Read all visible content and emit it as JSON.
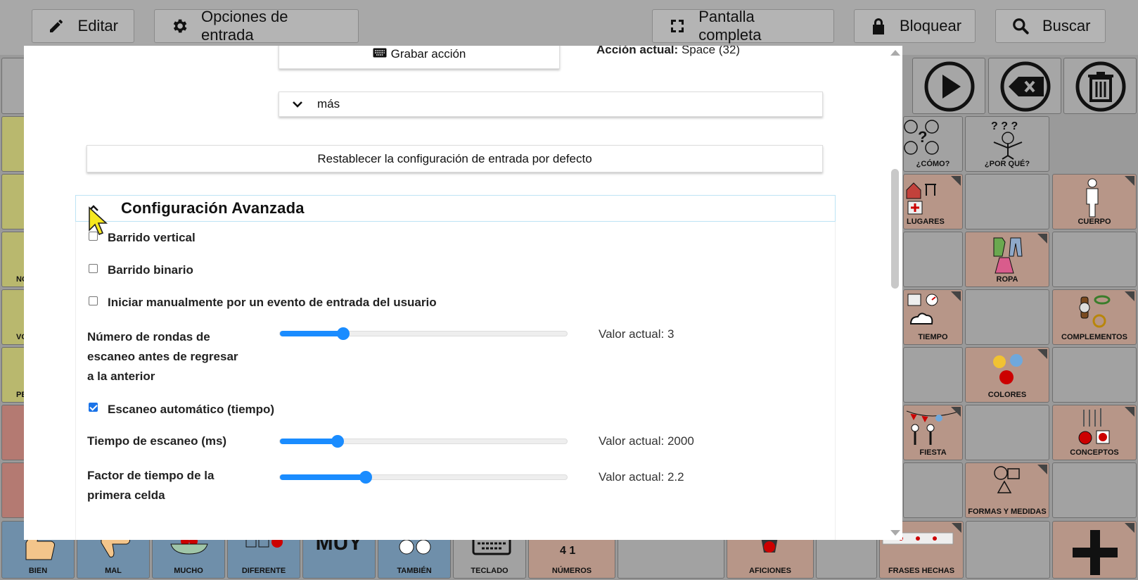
{
  "toolbar": {
    "edit_label": "Editar",
    "input_options_label": "Opciones de entrada",
    "fullscreen_label": "Pantalla completa",
    "lock_label": "Bloquear",
    "search_label": "Buscar"
  },
  "grid": {
    "labels": {
      "como": "¿CÓMO?",
      "por_que": "¿POR QUÉ?",
      "lugares": "LUGARES",
      "cuerpo": "CUERPO",
      "ropa": "ROPA",
      "tiempo": "TIEMPO",
      "complementos": "COMPLEMENTOS",
      "colores": "COLORES",
      "fiesta": "FIESTA",
      "conceptos": "CONCEPTOS",
      "formas": "FORMAS Y MEDIDAS",
      "bien": "BIEN",
      "mal": "MAL",
      "mucho": "MUCHO",
      "diferente": "DIFERENTE",
      "muy": "MUY",
      "tambien": "TAMBIÉN",
      "teclado": "TECLADO",
      "numeros": "NÚMEROS",
      "aficiones": "AFICIONES",
      "frases": "FRASES HECHAS",
      "no_partial": "NO",
      "vo_partial": "VO",
      "pe_partial": "PE"
    },
    "colors": {
      "yellow": "#b9b86e",
      "red": "#b47a72",
      "pink": "#b79688",
      "blue": "#6f8faa"
    }
  },
  "modal": {
    "record_action_label": "Grabar acción",
    "current_action_label": "Acción actual:",
    "current_action_value": "Space (32)",
    "more_label": "más",
    "reset_label": "Restablecer la configuración de entrada por defecto",
    "advanced": {
      "title": "Configuración Avanzada",
      "vertical_scan_label": "Barrido vertical",
      "vertical_scan_checked": false,
      "binary_scan_label": "Barrido binario",
      "binary_scan_checked": false,
      "manual_start_label": "Iniciar manualmente por un evento de entrada del usuario",
      "manual_start_checked": false,
      "rounds": {
        "label_line1": "Número de rondas de",
        "label_line2": "escaneo antes de regresar",
        "label_line3": "a la anterior",
        "value_text": "Valor actual: 3",
        "fraction": 0.22
      },
      "auto_scan_label": "Escaneo automático (tiempo)",
      "auto_scan_checked": true,
      "scan_time": {
        "label": "Tiempo de escaneo (ms)",
        "value_text": "Valor actual: 2000",
        "fraction": 0.2
      },
      "first_cell": {
        "label_line1": "Factor de tiempo de la",
        "label_line2": "primera celda",
        "value_text": "Valor actual: 2.2",
        "fraction": 0.3
      }
    }
  }
}
